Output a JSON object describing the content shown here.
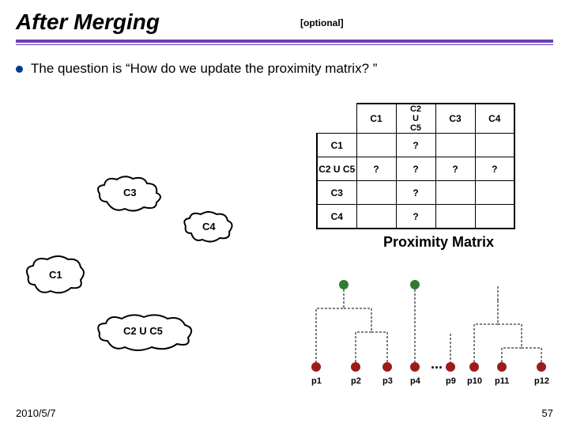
{
  "title": "After Merging",
  "optional_tag": "[optional]",
  "bullet_text": "The question is “How do we update the proximity matrix? ”",
  "matrix": {
    "col_headers": [
      "C1",
      "C2\nU\nC5",
      "C3",
      "C4"
    ],
    "row_headers": [
      "C1",
      "C2 U C5",
      "C3",
      "C4"
    ],
    "cells": [
      [
        "",
        "?",
        "",
        ""
      ],
      [
        "?",
        "?",
        "?",
        "?"
      ],
      [
        "",
        "?",
        "",
        ""
      ],
      [
        "",
        "?",
        "",
        ""
      ]
    ],
    "caption": "Proximity Matrix"
  },
  "clusters": {
    "c3": "C3",
    "c4": "C4",
    "c1": "C1",
    "c25": "C2 U C5"
  },
  "dendro": {
    "leaves": [
      "p1",
      "p2",
      "p3",
      "p4",
      "p9",
      "p10",
      "p11",
      "p12"
    ],
    "ellipsis": "..."
  },
  "footer": {
    "date": "2010/5/7",
    "page": "57"
  }
}
